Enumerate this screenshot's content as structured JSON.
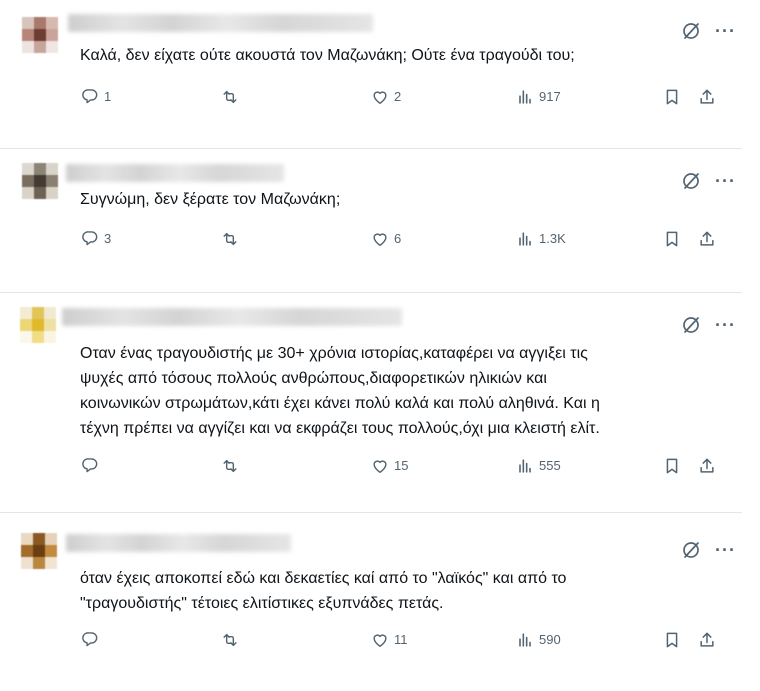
{
  "tweets": [
    {
      "text_lines": [
        "Καλά, δεν είχατε ούτε ακουστά τον Μαζωνάκη; Ούτε ένα τραγούδι του;"
      ],
      "replies": "1",
      "reposts": "",
      "likes": "2",
      "views": "917",
      "avatar_colors": [
        "#d8c4bd",
        "#a97a6b",
        "#d7b9b0",
        "#b78678",
        "#6e3d32",
        "#caa39a",
        "#ede3df",
        "#c7a59b",
        "#efe6e3"
      ]
    },
    {
      "text_lines": [
        "Συγνώμη, δεν ξέρατε τον Μαζωνάκη;"
      ],
      "replies": "3",
      "reposts": "",
      "likes": "6",
      "views": "1.3K",
      "avatar_colors": [
        "#dcd8cf",
        "#8c8576",
        "#d8d4ca",
        "#7a6e5f",
        "#433a31",
        "#8a7f70",
        "#dad4c8",
        "#6d6254",
        "#d9d3c7"
      ]
    },
    {
      "text_lines": [
        "Οταν ένας τραγουδιστής με 30+ χρόνια ιστορίας,καταφέρει να αγγιξει τις",
        "ψυχές από τόσους πολλούς ανθρώπους,διαφορετικών ηλικιών και",
        "κοινωνικών στρωμάτων,κάτι έχει κάνει πολύ καλά και πολύ αληθινά. Και η",
        "τέχνη πρέπει να αγγίζει και να εκφράζει τους πολλούς,όχι μια κλειστή ελίτ."
      ],
      "replies": "",
      "reposts": "",
      "likes": "15",
      "views": "555",
      "avatar_colors": [
        "#f3ecd2",
        "#e2c45a",
        "#f2ead0",
        "#ecd777",
        "#e0b92c",
        "#efe0a4",
        "#fbf7ea",
        "#f1dc88",
        "#faf5e3"
      ]
    },
    {
      "text_lines": [
        "όταν έχεις αποκοπεί εδώ και δεκαετίες καί από το \"λαϊκός\" και από το",
        "\"τραγουδιστής\" τέτοιες ελιτίστικες εξυπνάδες πετάς."
      ],
      "replies": "",
      "reposts": "",
      "likes": "11",
      "views": "590",
      "avatar_colors": [
        "#e9d8c2",
        "#8a5a22",
        "#e6d2ba",
        "#a46c2a",
        "#6b3e12",
        "#c48b3f",
        "#efe1cf",
        "#b9873f",
        "#f0e4d2"
      ]
    }
  ],
  "icons": {
    "reply": "reply-icon",
    "repost": "repost-icon",
    "like": "like-icon",
    "views": "views-icon",
    "bookmark": "bookmark-icon",
    "share": "share-icon",
    "grok": "grok-icon",
    "more": "more-icon"
  },
  "more_label": "···",
  "colors": {
    "icon": "#536471",
    "text": "#0f1419",
    "separator": "#e3e6e9"
  }
}
